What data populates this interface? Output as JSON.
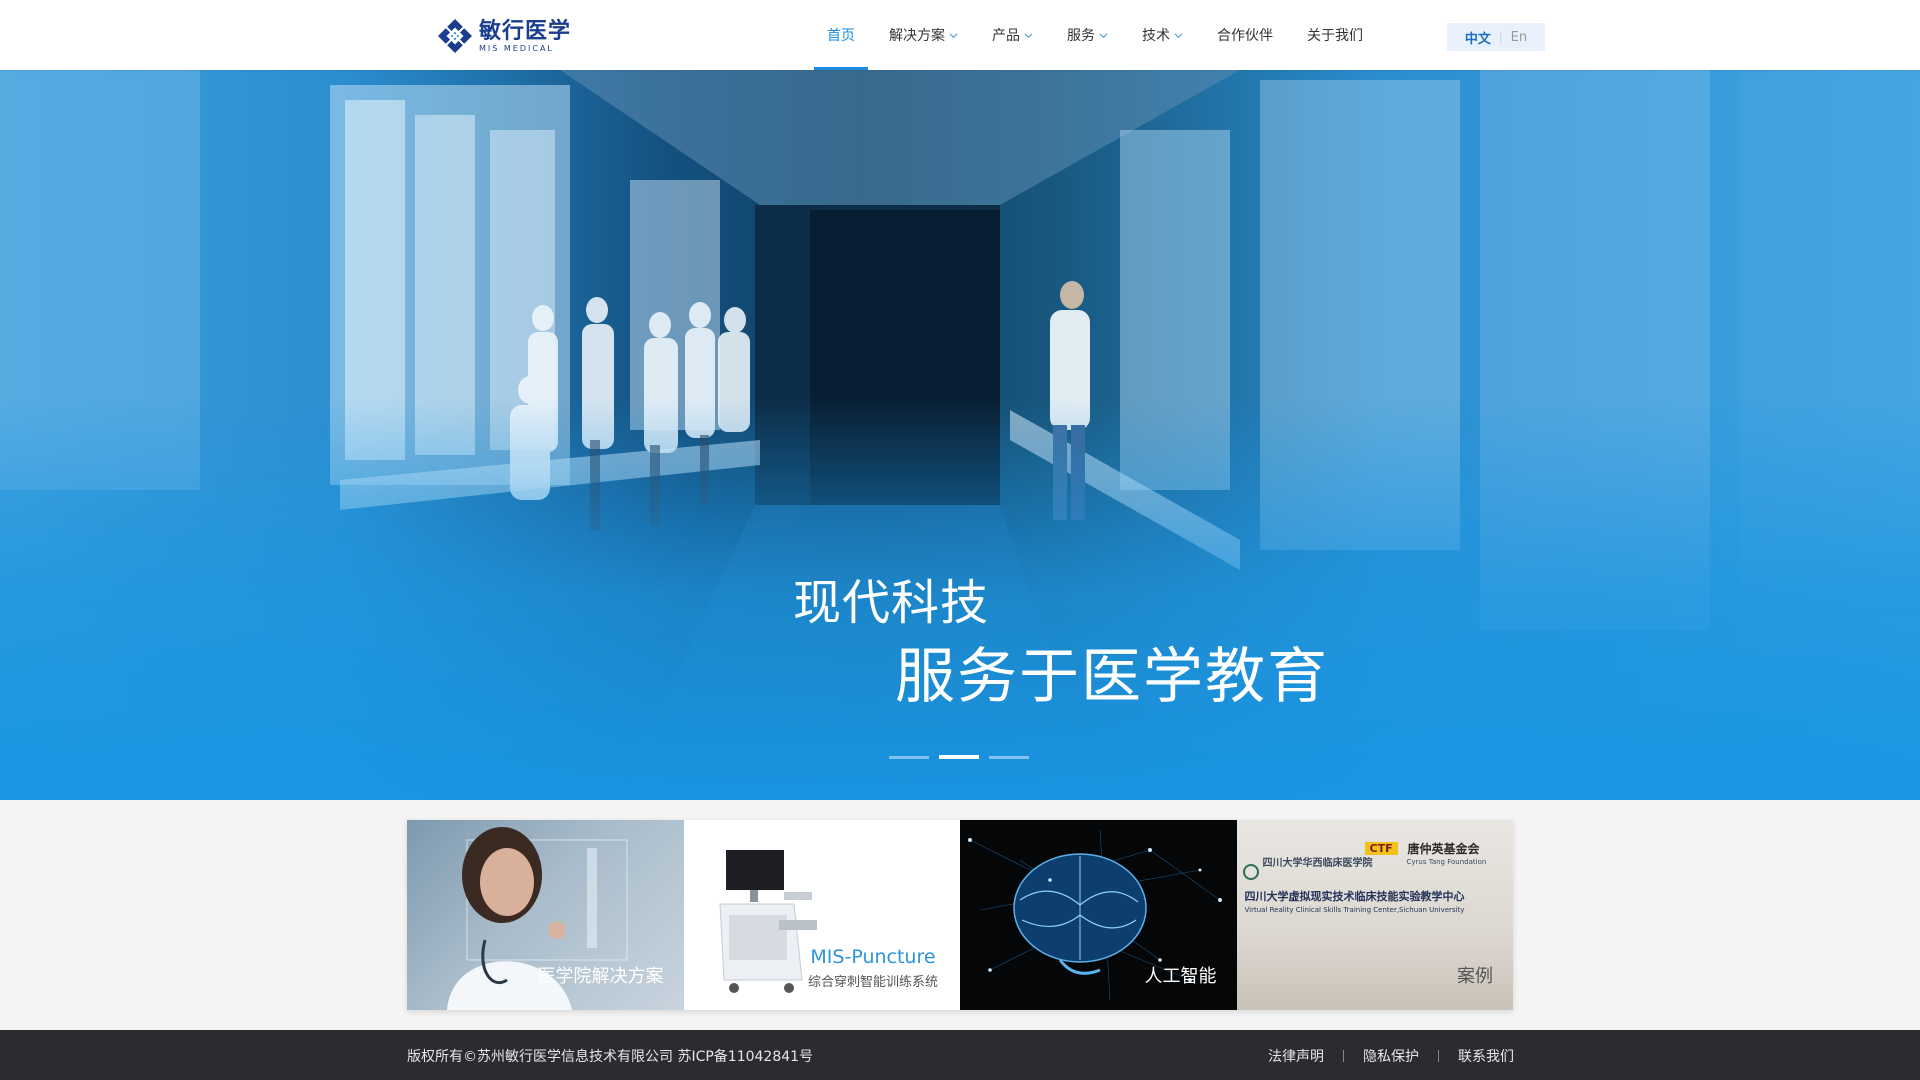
{
  "brand": {
    "name_cn": "敏行医学",
    "name_en": "MIS MEDICAL"
  },
  "nav": [
    {
      "label": "首页",
      "dropdown": false,
      "active": true
    },
    {
      "label": "解决方案",
      "dropdown": true
    },
    {
      "label": "产品",
      "dropdown": true
    },
    {
      "label": "服务",
      "dropdown": true
    },
    {
      "label": "技术",
      "dropdown": true
    },
    {
      "label": "合作伙伴",
      "dropdown": false
    },
    {
      "label": "关于我们",
      "dropdown": false
    }
  ],
  "lang": {
    "zh": "中文",
    "en": "En"
  },
  "hero": {
    "line1": "现代科技",
    "line2": "服务于医学教育",
    "slides": 3,
    "active_slide": 2
  },
  "cards": [
    {
      "label": "医学院解决方案"
    },
    {
      "label": "MIS-Puncture",
      "sublabel": "综合穿刺智能训练系统"
    },
    {
      "label": "人工智能"
    },
    {
      "label": "案例",
      "sign_line1": "四川大学华西临床医学院",
      "sign_ctf": "CTF",
      "sign_foundation_cn": "唐仲英基金会",
      "sign_foundation_en": "Cyrus Tang Foundation",
      "sign_main": "四川大学虚拟现实技术临床技能实验教学中心",
      "sign_main_en": "Virtual Reality Clinical Skills Training Center,Sichuan University"
    }
  ],
  "footer": {
    "copyright": "版权所有©苏州敏行医学信息技术有限公司  苏ICP备11042841号",
    "links": [
      "法律声明",
      "隐私保护",
      "联系我们"
    ]
  },
  "colors": {
    "accent": "#1a8be0",
    "brand": "#1a3d8f",
    "footer_bg": "#2a2c32",
    "hero_blue": "#2b95dc"
  }
}
